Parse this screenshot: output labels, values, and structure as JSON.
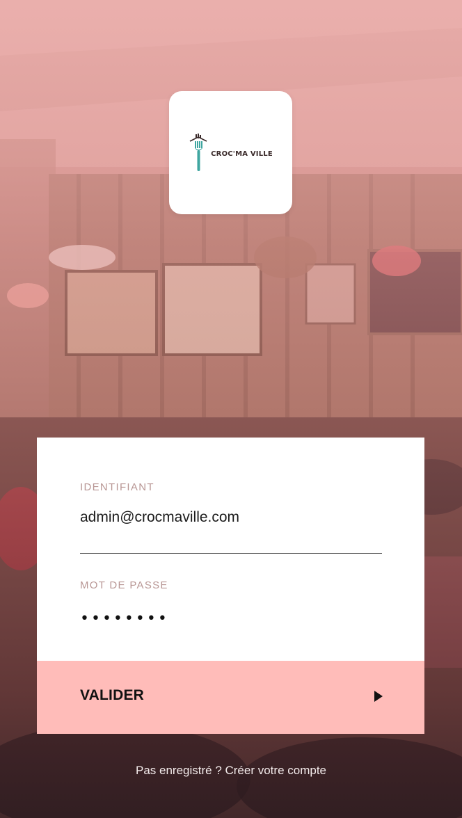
{
  "brand": {
    "logo_text": "CROC'MA VILLE",
    "fork_color": "#3fa6a0",
    "text_color": "#3a2a2a"
  },
  "form": {
    "username_label": "IDENTIFIANT",
    "username_value": "admin@crocmaville.com",
    "password_label": "MOT DE PASSE",
    "password_mask": "••••••••",
    "submit_label": "VALIDER",
    "submit_icon": "play-arrow-icon"
  },
  "footer": {
    "register_link": "Pas enregistré ? Créer votre compte"
  },
  "colors": {
    "accent": "#ffbcb9",
    "label": "#b89694",
    "background_tint": "#e6a9a6"
  }
}
